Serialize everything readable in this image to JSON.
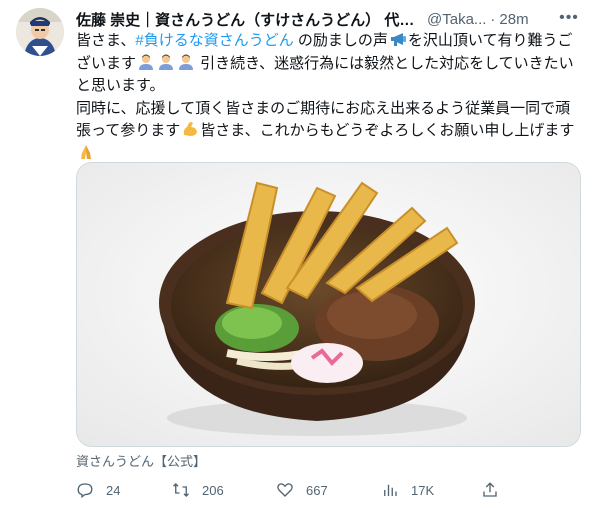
{
  "tweet": {
    "author_name": "佐藤 崇史｜資さんうどん（すけさんうどん） 代表...",
    "handle": "@Taka...",
    "separator": "·",
    "time": "28m",
    "more_label": "•••",
    "body": {
      "l1_a": "皆さま、",
      "hashtag": "#負けるな資さんうどん",
      "l1_b": " の励ましの声",
      "l1_c": "を沢山頂いて有り難うご",
      "l2_a": "ざいます",
      "l2_b": " 引き続き、迷惑行為には毅然とした対応をしていきたい",
      "l3": "と思います。",
      "l4": "同時に、応援して頂く皆さまのご期待にお応え出来るよう従業員一同で頑",
      "l5_a": "張って参ります",
      "l5_b": "皆さま、これからもどうぞよろしくお願い申し上げます"
    },
    "media_source": "資さんうどん【公式】",
    "stats": {
      "replies": "24",
      "retweets": "206",
      "likes": "667",
      "views": "17K"
    }
  },
  "icons": {
    "megaphone": "megaphone-icon",
    "bow": "bowing-person-icon",
    "muscle": "flexed-biceps-icon",
    "pray": "folded-hands-icon",
    "reply": "reply-icon",
    "retweet": "retweet-icon",
    "like": "heart-icon",
    "views": "bar-chart-icon",
    "share": "share-icon"
  },
  "colors": {
    "text": "#0f1419",
    "secondary": "#536471",
    "link": "#1d9bf0",
    "border": "#cfd9de"
  }
}
